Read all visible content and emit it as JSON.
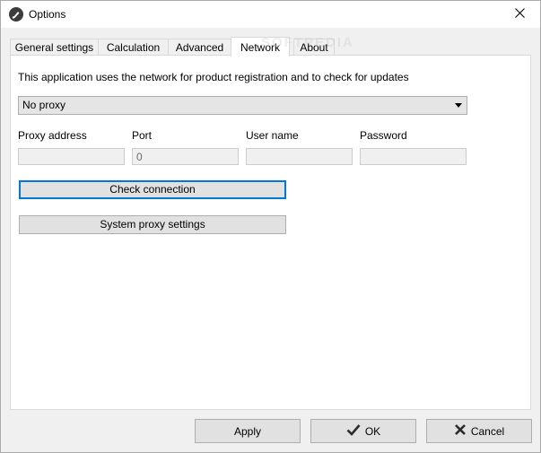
{
  "window": {
    "title": "Options",
    "icon": "app-brush-icon",
    "close_icon": "close-icon"
  },
  "tabs": [
    {
      "label": "General settings",
      "active": false
    },
    {
      "label": "Calculation",
      "active": false
    },
    {
      "label": "Advanced",
      "active": false
    },
    {
      "label": "Network",
      "active": true
    },
    {
      "label": "About",
      "active": false
    }
  ],
  "network": {
    "info_text": "This application uses the network for product registration and to check for updates",
    "proxy_mode": {
      "selected": "No proxy"
    },
    "fields": {
      "proxy_address": {
        "label": "Proxy address",
        "value": ""
      },
      "port": {
        "label": "Port",
        "value": "0"
      },
      "user_name": {
        "label": "User name",
        "value": ""
      },
      "password": {
        "label": "Password",
        "value": ""
      }
    },
    "check_connection_label": "Check connection",
    "system_proxy_label": "System proxy settings"
  },
  "footer": {
    "apply_label": "Apply",
    "ok_label": "OK",
    "cancel_label": "Cancel",
    "ok_icon": "checkmark-icon",
    "cancel_icon": "x-icon"
  },
  "watermark": "SOFTPEDIA",
  "colors": {
    "focus_border": "#0078d7",
    "window_bg": "#f0f0f0",
    "panel_bg": "#ffffff"
  }
}
